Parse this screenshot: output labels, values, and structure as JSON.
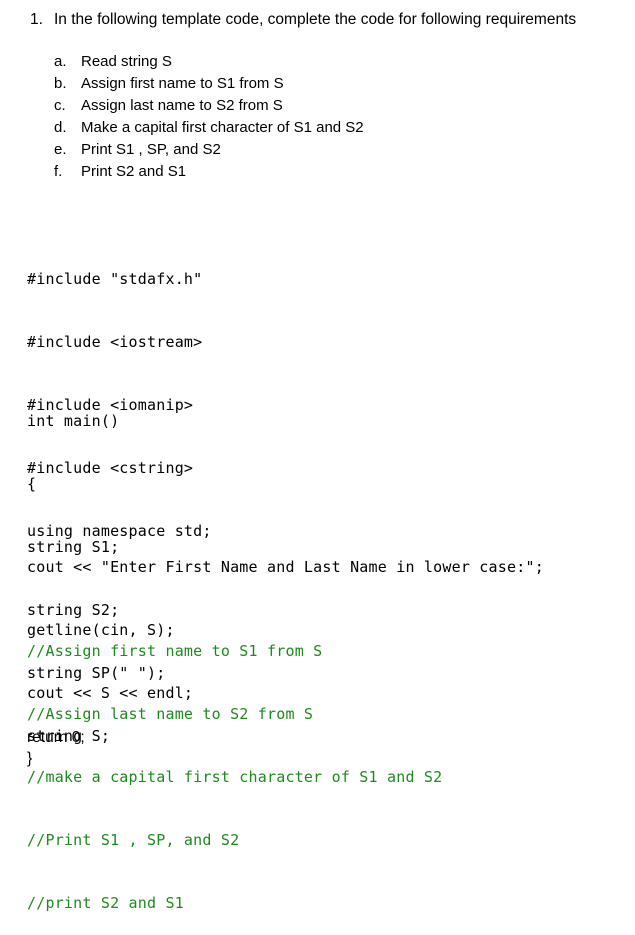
{
  "question": {
    "number": "1.",
    "text": "In the following template code, complete the code for following requirements"
  },
  "requirements": [
    {
      "letter": "a.",
      "text": "Read string S"
    },
    {
      "letter": "b.",
      "text": "Assign first name to S1 from S"
    },
    {
      "letter": "c.",
      "text": "Assign last name to S2 from S"
    },
    {
      "letter": "d.",
      "text": "Make a capital first character of S1 and S2"
    },
    {
      "letter": "e.",
      "text": "Print S1 , SP, and S2"
    },
    {
      "letter": "f.",
      "text": "Print S2  and S1"
    }
  ],
  "code": {
    "includes": [
      "#include \"stdafx.h\"",
      "#include <iostream>",
      "#include <iomanip>",
      "#include <cstring>",
      "using namespace std;"
    ],
    "main_header": [
      "int main()",
      "{",
      "string S1;",
      "string S2;",
      "string SP(\" \");",
      "string S;"
    ],
    "io_lines": [
      "cout << \"Enter First Name and Last Name in lower case:\";",
      "getline(cin, S);",
      "cout << S << endl;"
    ],
    "comments": [
      "//Assign first name to S1 from S",
      "//Assign last name to S2 from S",
      "//make a capital first character of S1 and S2",
      "//Print S1 , SP, and S2",
      "//print S2 and S1"
    ],
    "footer": [
      "return 0;",
      "}"
    ],
    "comment_color": "#1e8a1e"
  }
}
